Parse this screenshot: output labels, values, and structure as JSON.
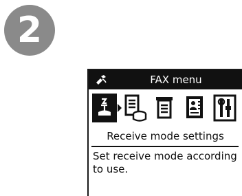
{
  "step": {
    "number": "2"
  },
  "lcd": {
    "title": "FAX menu",
    "icons": [
      {
        "name": "receive-mode-icon",
        "selected": true
      },
      {
        "name": "memory-reference-icon",
        "selected": false
      },
      {
        "name": "report-list-icon",
        "selected": false
      },
      {
        "name": "phone-directory-icon",
        "selected": false
      },
      {
        "name": "fax-settings-icon",
        "selected": false
      }
    ],
    "caption": "Receive mode settings",
    "description": "Set receive mode according to use."
  }
}
